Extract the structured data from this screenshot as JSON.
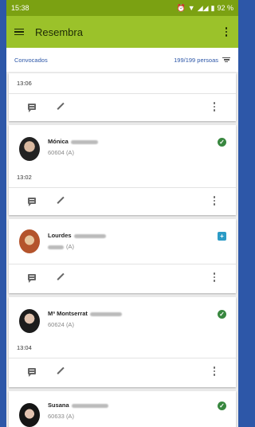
{
  "statusbar": {
    "time": "15:38",
    "battery": "92 %"
  },
  "appbar": {
    "title": "Resembra"
  },
  "subheader": {
    "left": "Convocados",
    "right": "199/199 persoas"
  },
  "cards": [
    {
      "time": "13:06"
    },
    {
      "name": "Mónica",
      "code": "60604 (A)",
      "time": "13:02",
      "status": "check"
    },
    {
      "name": "Lourdes",
      "code": "(A)",
      "status": "plus"
    },
    {
      "name": "Mª Montserrat",
      "code": "60624 (A)",
      "time": "13:04",
      "status": "check"
    },
    {
      "name": "Susana",
      "code": "60633 (A)",
      "status": "check"
    }
  ],
  "colors": {
    "statusbar": "#7ba112",
    "appbar": "#9bc22a",
    "accent": "#2d57a8",
    "ok": "#38873f",
    "plus": "#2b9bc6"
  }
}
